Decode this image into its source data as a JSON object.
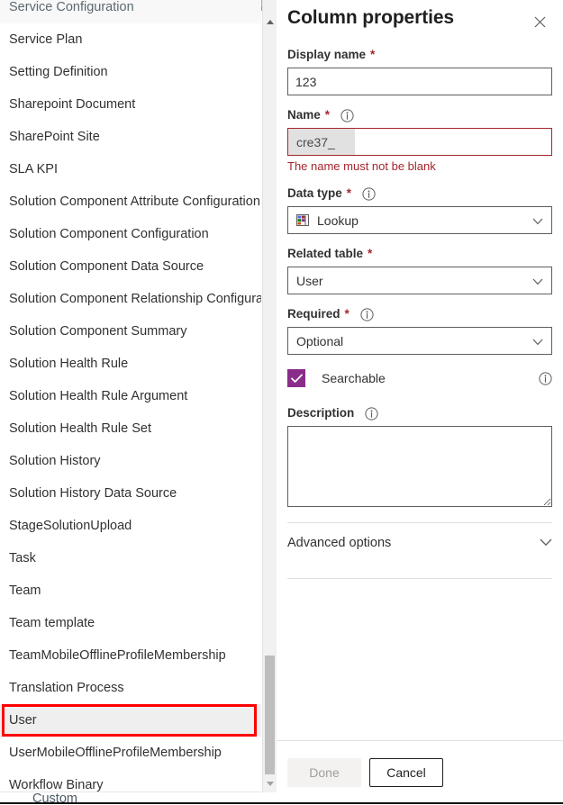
{
  "table_list": {
    "items": [
      {
        "label": "Service Configuration",
        "state": "clipped-top"
      },
      {
        "label": "Service Plan",
        "state": "normal"
      },
      {
        "label": "Setting Definition",
        "state": "normal"
      },
      {
        "label": "Sharepoint Document",
        "state": "normal"
      },
      {
        "label": "SharePoint Site",
        "state": "normal"
      },
      {
        "label": "SLA KPI",
        "state": "normal"
      },
      {
        "label": "Solution Component Attribute Configuration",
        "state": "normal"
      },
      {
        "label": "Solution Component Configuration",
        "state": "normal"
      },
      {
        "label": "Solution Component Data Source",
        "state": "normal"
      },
      {
        "label": "Solution Component Relationship Configurati",
        "state": "truncated"
      },
      {
        "label": "Solution Component Summary",
        "state": "normal"
      },
      {
        "label": "Solution Health Rule",
        "state": "normal"
      },
      {
        "label": "Solution Health Rule Argument",
        "state": "normal"
      },
      {
        "label": "Solution Health Rule Set",
        "state": "normal"
      },
      {
        "label": "Solution History",
        "state": "normal"
      },
      {
        "label": "Solution History Data Source",
        "state": "normal"
      },
      {
        "label": "StageSolutionUpload",
        "state": "normal"
      },
      {
        "label": "Task",
        "state": "normal"
      },
      {
        "label": "Team",
        "state": "normal"
      },
      {
        "label": "Team template",
        "state": "normal"
      },
      {
        "label": "TeamMobileOfflineProfileMembership",
        "state": "normal"
      },
      {
        "label": "Translation Process",
        "state": "normal"
      },
      {
        "label": "User",
        "state": "selected"
      },
      {
        "label": "UserMobileOfflineProfileMembership",
        "state": "normal"
      },
      {
        "label": "Workflow Binary",
        "state": "normal"
      }
    ],
    "partial_below": "Custom",
    "annotation_color": "#ff0000",
    "selected_label": "User"
  },
  "scrollbar": {
    "up_arrow": "scroll-up-arrow",
    "down_arrow": "scroll-down-arrow"
  },
  "panel": {
    "title": "Column properties",
    "close_label": "Close",
    "display_name": {
      "label": "Display name",
      "required_marker": "*",
      "value": "123",
      "placeholder": ""
    },
    "name": {
      "label": "Name",
      "required_marker": "*",
      "prefix": "cre37_",
      "value": "",
      "placeholder": "",
      "error": "The name must not be blank",
      "error_color": "#a4262c"
    },
    "data_type": {
      "label": "Data type",
      "required_marker": "*",
      "value": "Lookup",
      "icon": "lookup-table-icon"
    },
    "related_table": {
      "label": "Related table",
      "required_marker": "*",
      "value": "User"
    },
    "required": {
      "label": "Required",
      "required_marker": "*",
      "value": "Optional"
    },
    "searchable": {
      "label": "Searchable",
      "checked": true,
      "accent_color": "#8a2d8a"
    },
    "description": {
      "label": "Description",
      "value": "",
      "placeholder": ""
    },
    "advanced_options": {
      "label": "Advanced options",
      "expanded": false
    },
    "footer": {
      "done_label": "Done",
      "done_disabled": true,
      "cancel_label": "Cancel"
    }
  }
}
